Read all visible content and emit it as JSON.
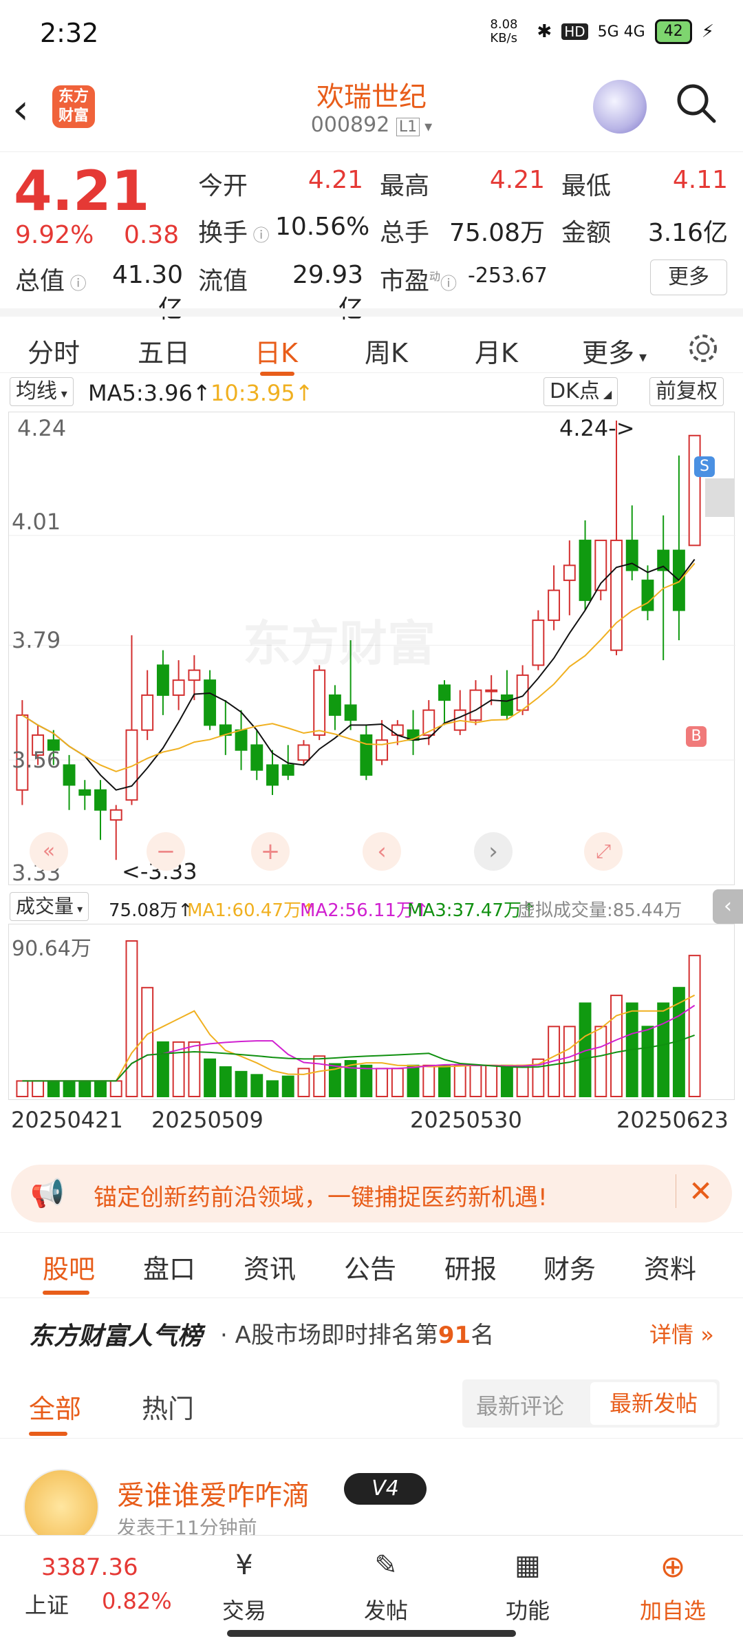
{
  "status": {
    "time": "2:32",
    "net": "8.08 KB/s",
    "signal": "5G 4G",
    "battery": "42"
  },
  "header": {
    "name": "欢瑞世纪",
    "code": "000892",
    "level": "L1",
    "logo": "东方\n财富"
  },
  "quote": {
    "price": "4.21",
    "pct": "9.92%",
    "change": "0.38",
    "open_label": "今开",
    "open": "4.21",
    "high_label": "最高",
    "high": "4.21",
    "low_label": "最低",
    "low": "4.11",
    "turnover_label": "换手",
    "turnover": "10.56%",
    "vol_label": "总手",
    "vol": "75.08万",
    "amount_label": "金额",
    "amount": "3.16亿",
    "mcap_label": "总值",
    "mcap": "41.30亿",
    "float_label": "流值",
    "float": "29.93亿",
    "pe_label": "市盈",
    "pe_sup": "动",
    "pe": "-253.67",
    "more": "更多"
  },
  "tabs": [
    "分时",
    "五日",
    "日K",
    "周K",
    "月K",
    "更多"
  ],
  "ma": {
    "sel": "均线",
    "ma5": "MA5:3.96",
    "ma10": "10:3.95",
    "dk": "DK点",
    "fq": "前复权"
  },
  "chart": {
    "y_labels": [
      "4.24",
      "4.01",
      "3.79",
      "3.56",
      "3.33"
    ],
    "max_note": "4.24->",
    "min_note": "<-3.33",
    "watermark": "东方财富",
    "s_mark": "S",
    "b_mark": "B"
  },
  "vol": {
    "sel": "成交量",
    "v": "75.08万",
    "ma1": "MA1:60.47万",
    "ma2": "MA2:56.11万",
    "ma3": "MA3:37.47万",
    "virtual": "虚拟成交量:85.44万",
    "top": "90.64万"
  },
  "dates": [
    "20250421",
    "20250509",
    "20250530",
    "20250623"
  ],
  "banner": {
    "text": "锚定创新药前沿领域，一键捕捉医药新机遇!"
  },
  "btabs": [
    "股吧",
    "盘口",
    "资讯",
    "公告",
    "研报",
    "财务",
    "资料"
  ],
  "rank": {
    "brand": "东方财富人气榜",
    "pre": "A股市场即时排名第",
    "num": "91",
    "post": "名",
    "detail": "详情"
  },
  "subtabs": {
    "all": "全部",
    "hot": "热门",
    "latest_comment": "最新评论",
    "latest_post": "最新发帖"
  },
  "post": {
    "user": "爱谁谁爱咋咋滴",
    "badge": "V4",
    "time": "发表于11分钟前"
  },
  "dock": {
    "index_val": "3387.36",
    "index_name": "上证",
    "index_pct": "0.82%",
    "trade": "交易",
    "post": "发帖",
    "func": "功能",
    "add": "加自选"
  },
  "chart_data": {
    "type": "candlestick",
    "ylim": [
      3.33,
      4.24
    ],
    "candles": [
      [
        3.5,
        3.65,
        3.68,
        3.47
      ],
      [
        3.57,
        3.61,
        3.63,
        3.55
      ],
      [
        3.6,
        3.58,
        3.62,
        3.55
      ],
      [
        3.55,
        3.51,
        3.57,
        3.46
      ],
      [
        3.5,
        3.49,
        3.52,
        3.46
      ],
      [
        3.5,
        3.46,
        3.52,
        3.4
      ],
      [
        3.44,
        3.46,
        3.47,
        3.36
      ],
      [
        3.48,
        3.62,
        3.81,
        3.47
      ],
      [
        3.62,
        3.69,
        3.74,
        3.6
      ],
      [
        3.75,
        3.69,
        3.78,
        3.65
      ],
      [
        3.69,
        3.72,
        3.76,
        3.66
      ],
      [
        3.72,
        3.74,
        3.77,
        3.68
      ],
      [
        3.72,
        3.63,
        3.74,
        3.62
      ],
      [
        3.63,
        3.61,
        3.68,
        3.57
      ],
      [
        3.62,
        3.58,
        3.66,
        3.54
      ],
      [
        3.59,
        3.54,
        3.62,
        3.52
      ],
      [
        3.55,
        3.51,
        3.58,
        3.49
      ],
      [
        3.55,
        3.53,
        3.59,
        3.52
      ],
      [
        3.56,
        3.59,
        3.6,
        3.55
      ],
      [
        3.61,
        3.74,
        3.75,
        3.6
      ],
      [
        3.69,
        3.65,
        3.71,
        3.62
      ],
      [
        3.67,
        3.64,
        3.8,
        3.62
      ],
      [
        3.61,
        3.53,
        3.63,
        3.52
      ],
      [
        3.56,
        3.6,
        3.64,
        3.55
      ],
      [
        3.61,
        3.63,
        3.64,
        3.59
      ],
      [
        3.62,
        3.6,
        3.66,
        3.57
      ],
      [
        3.61,
        3.66,
        3.68,
        3.59
      ],
      [
        3.71,
        3.68,
        3.72,
        3.63
      ],
      [
        3.62,
        3.66,
        3.7,
        3.61
      ],
      [
        3.64,
        3.7,
        3.72,
        3.63
      ],
      [
        3.7,
        3.7,
        3.73,
        3.67
      ],
      [
        3.69,
        3.65,
        3.74,
        3.64
      ],
      [
        3.66,
        3.73,
        3.75,
        3.65
      ],
      [
        3.75,
        3.84,
        3.86,
        3.74
      ],
      [
        3.84,
        3.9,
        3.95,
        3.82
      ],
      [
        3.92,
        3.95,
        4.0,
        3.85
      ],
      [
        4.0,
        3.88,
        4.04,
        3.86
      ],
      [
        3.9,
        4.0,
        4.0,
        3.88
      ],
      [
        3.78,
        4.0,
        4.24,
        3.77
      ],
      [
        4.0,
        3.94,
        4.07,
        3.92
      ],
      [
        3.92,
        3.86,
        3.95,
        3.84
      ],
      [
        3.98,
        3.94,
        4.05,
        3.76
      ],
      [
        3.98,
        3.86,
        4.17,
        3.8
      ],
      [
        3.99,
        4.21,
        4.21,
        4.11
      ]
    ],
    "volume": [
      10,
      10,
      10,
      10,
      10,
      10,
      10,
      100,
      70,
      35,
      35,
      35,
      24,
      19,
      16,
      14,
      10,
      13,
      18,
      26,
      21,
      23,
      20,
      18,
      18,
      20,
      20,
      20,
      20,
      20,
      20,
      20,
      20,
      24,
      45,
      45,
      60,
      45,
      65,
      60,
      45,
      60,
      70,
      90.64
    ]
  }
}
